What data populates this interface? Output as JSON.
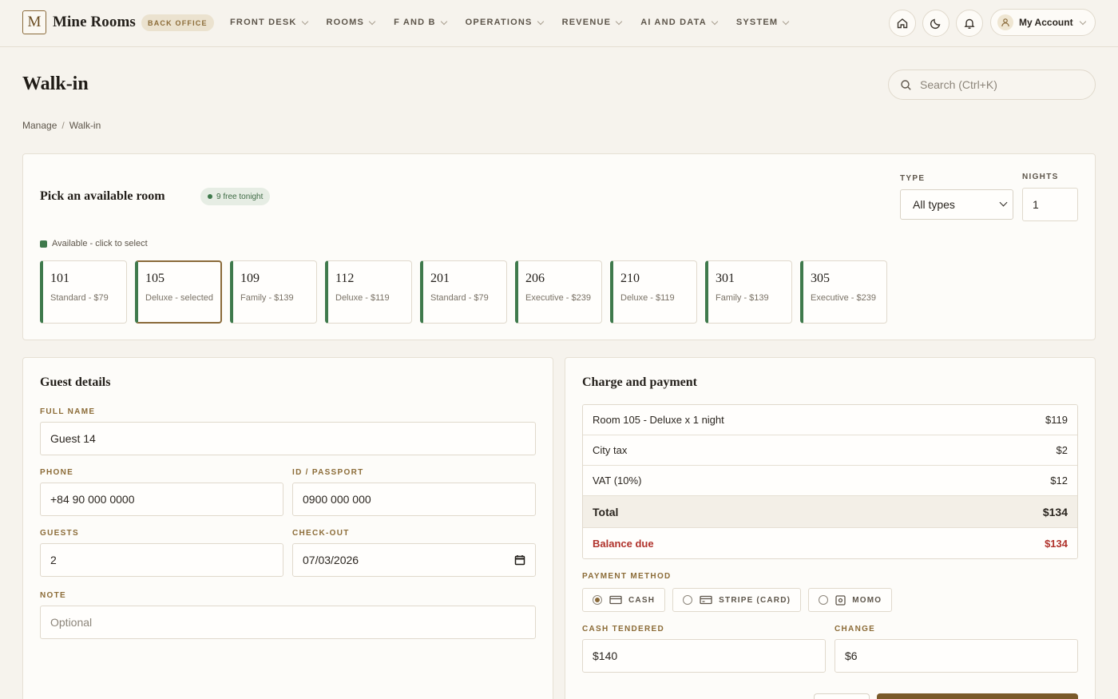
{
  "brand": {
    "logo_letter": "M",
    "name": "Mine Rooms",
    "badge": "BACK OFFICE"
  },
  "nav": [
    {
      "label": "FRONT DESK"
    },
    {
      "label": "ROOMS"
    },
    {
      "label": "F AND B"
    },
    {
      "label": "OPERATIONS"
    },
    {
      "label": "REVENUE"
    },
    {
      "label": "AI AND DATA"
    },
    {
      "label": "SYSTEM"
    }
  ],
  "header_icons": [
    "home-icon",
    "moon-icon",
    "bell-icon"
  ],
  "account": {
    "label": "My Account",
    "icon": "user-icon"
  },
  "page": {
    "title": "Walk-in"
  },
  "search": {
    "placeholder": "Search (Ctrl+K)",
    "icon": "search-icon"
  },
  "breadcrumb": {
    "items": [
      "Manage",
      "Walk-in"
    ],
    "separator": "/"
  },
  "room_picker": {
    "title": "Pick an available room",
    "free_badge": "9 free tonight",
    "legend": "Available - click to select",
    "type_label": "TYPE",
    "type_value": "All types",
    "nights_label": "NIGHTS",
    "nights_value": "1",
    "rooms": [
      {
        "number": "101",
        "desc": "Standard - $79",
        "selected": false
      },
      {
        "number": "105",
        "desc": "Deluxe - selected",
        "selected": true
      },
      {
        "number": "109",
        "desc": "Family - $139",
        "selected": false
      },
      {
        "number": "112",
        "desc": "Deluxe - $119",
        "selected": false
      },
      {
        "number": "201",
        "desc": "Standard - $79",
        "selected": false
      },
      {
        "number": "206",
        "desc": "Executive - $239",
        "selected": false
      },
      {
        "number": "210",
        "desc": "Deluxe - $119",
        "selected": false
      },
      {
        "number": "301",
        "desc": "Family - $139",
        "selected": false
      },
      {
        "number": "305",
        "desc": "Executive - $239",
        "selected": false
      }
    ]
  },
  "guest": {
    "title": "Guest details",
    "full_name_label": "FULL NAME",
    "full_name_value": "Guest 14",
    "phone_label": "PHONE",
    "phone_value": "+84 90 000 0000",
    "id_label": "ID / PASSPORT",
    "id_value": "0900 000 000",
    "guests_label": "GUESTS",
    "guests_value": "2",
    "checkout_label": "CHECK-OUT",
    "checkout_value": "07/03/2026",
    "note_label": "NOTE",
    "note_placeholder": "Optional"
  },
  "charges": {
    "title": "Charge and payment",
    "lines": [
      {
        "label": "Room 105 - Deluxe x 1 night",
        "amount": "$119"
      },
      {
        "label": "City tax",
        "amount": "$2"
      },
      {
        "label": "VAT (10%)",
        "amount": "$12"
      }
    ],
    "total_label": "Total",
    "total_amount": "$134",
    "due_label": "Balance due",
    "due_amount": "$134",
    "payment_method_label": "PAYMENT METHOD",
    "methods": [
      {
        "label": "CASH",
        "icon": "cash-icon",
        "selected": true
      },
      {
        "label": "STRIPE (CARD)",
        "icon": "card-icon",
        "selected": false
      },
      {
        "label": "MOMO",
        "icon": "wallet-icon",
        "selected": false
      }
    ],
    "tendered_label": "CASH TENDERED",
    "tendered_value": "$140",
    "change_label": "CHANGE",
    "change_value": "$6"
  },
  "colors": {
    "accent": "#8a6a3a",
    "available": "#3f7a4c",
    "due": "#b0332c",
    "background": "#f6f3ed"
  }
}
